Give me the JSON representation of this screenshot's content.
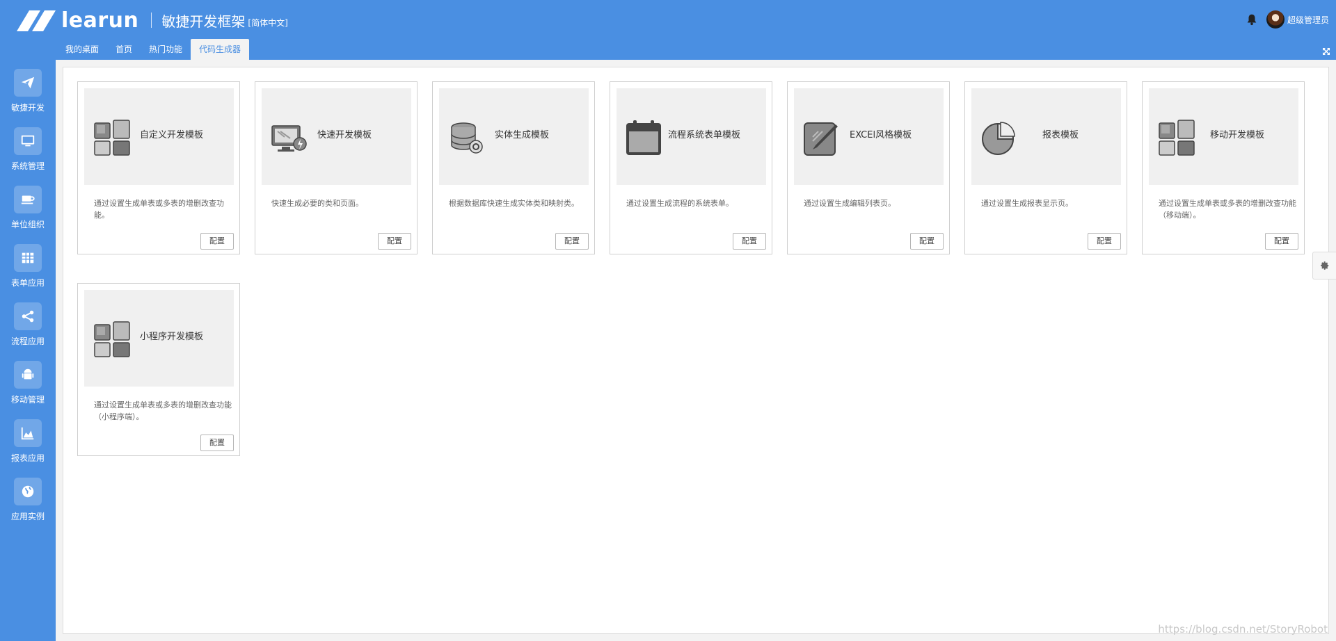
{
  "header": {
    "brand": "learun",
    "subtitle": "敏捷开发框架",
    "language": "[简体中文]",
    "user_name": "超级管理员"
  },
  "tabs": [
    {
      "label": "我的桌面"
    },
    {
      "label": "首页"
    },
    {
      "label": "热门功能"
    },
    {
      "label": "代码生成器"
    }
  ],
  "sidebar": {
    "items": [
      {
        "label": "敏捷开发",
        "icon": "paper-plane-icon"
      },
      {
        "label": "系统管理",
        "icon": "monitor-icon"
      },
      {
        "label": "单位组织",
        "icon": "coffee-icon"
      },
      {
        "label": "表单应用",
        "icon": "table-icon"
      },
      {
        "label": "流程应用",
        "icon": "share-icon"
      },
      {
        "label": "移动管理",
        "icon": "android-icon"
      },
      {
        "label": "报表应用",
        "icon": "area-chart-icon"
      },
      {
        "label": "应用实例",
        "icon": "globe-icon"
      }
    ]
  },
  "cards": [
    {
      "title": "自定义开发模板",
      "desc": "通过设置生成单表或多表的增删改查功能。",
      "button": "配置",
      "icon": "tiles-icon"
    },
    {
      "title": "快速开发模板",
      "desc": "快速生成必要的类和页面。",
      "button": "配置",
      "icon": "monitor-lightning-icon"
    },
    {
      "title": "实体生成模板",
      "desc": "根据数据库快速生成实体类和映射类。",
      "button": "配置",
      "icon": "database-icon"
    },
    {
      "title": "流程系统表单模板",
      "desc": "通过设置生成流程的系统表单。",
      "button": "配置",
      "icon": "calendar-icon"
    },
    {
      "title": "EXCEl风格模板",
      "desc": "通过设置生成编辑列表页。",
      "button": "配置",
      "icon": "edit-icon"
    },
    {
      "title": "报表模板",
      "desc": "通过设置生成报表显示页。",
      "button": "配置",
      "icon": "pie-chart-icon"
    },
    {
      "title": "移动开发模板",
      "desc": "通过设置生成单表或多表的增删改查功能（移动端）。",
      "button": "配置",
      "icon": "tiles-icon"
    },
    {
      "title": "小程序开发模板",
      "desc": "通过设置生成单表或多表的增删改查功能（小程序端）。",
      "button": "配置",
      "icon": "tiles-icon"
    }
  ],
  "watermark": "https://blog.csdn.net/StoryRobot",
  "colors": {
    "primary": "#4a8fe2",
    "card_head": "#f0f0f0",
    "icon_gray": "#777777"
  }
}
